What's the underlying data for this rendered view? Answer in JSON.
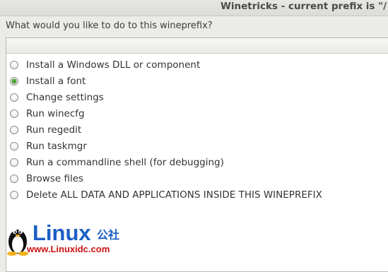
{
  "window": {
    "title": "Winetricks - current prefix is \"/"
  },
  "prompt": "What would you like to do to this wineprefix?",
  "options": [
    {
      "label": "Install a Windows DLL or component",
      "selected": false
    },
    {
      "label": "Install a font",
      "selected": true
    },
    {
      "label": "Change settings",
      "selected": false
    },
    {
      "label": "Run winecfg",
      "selected": false
    },
    {
      "label": "Run regedit",
      "selected": false
    },
    {
      "label": "Run taskmgr",
      "selected": false
    },
    {
      "label": "Run a commandline shell (for debugging)",
      "selected": false
    },
    {
      "label": "Browse files",
      "selected": false
    },
    {
      "label": "Delete ALL DATA AND APPLICATIONS INSIDE THIS WINEPREFIX",
      "selected": false
    }
  ],
  "watermark": {
    "brand": "Linux",
    "cn": "公社",
    "url": "www.Linuxidc.com"
  },
  "colors": {
    "selected_radio": "#56a83a",
    "watermark_blue": "#1a5fc4",
    "watermark_red": "#cc1111"
  }
}
